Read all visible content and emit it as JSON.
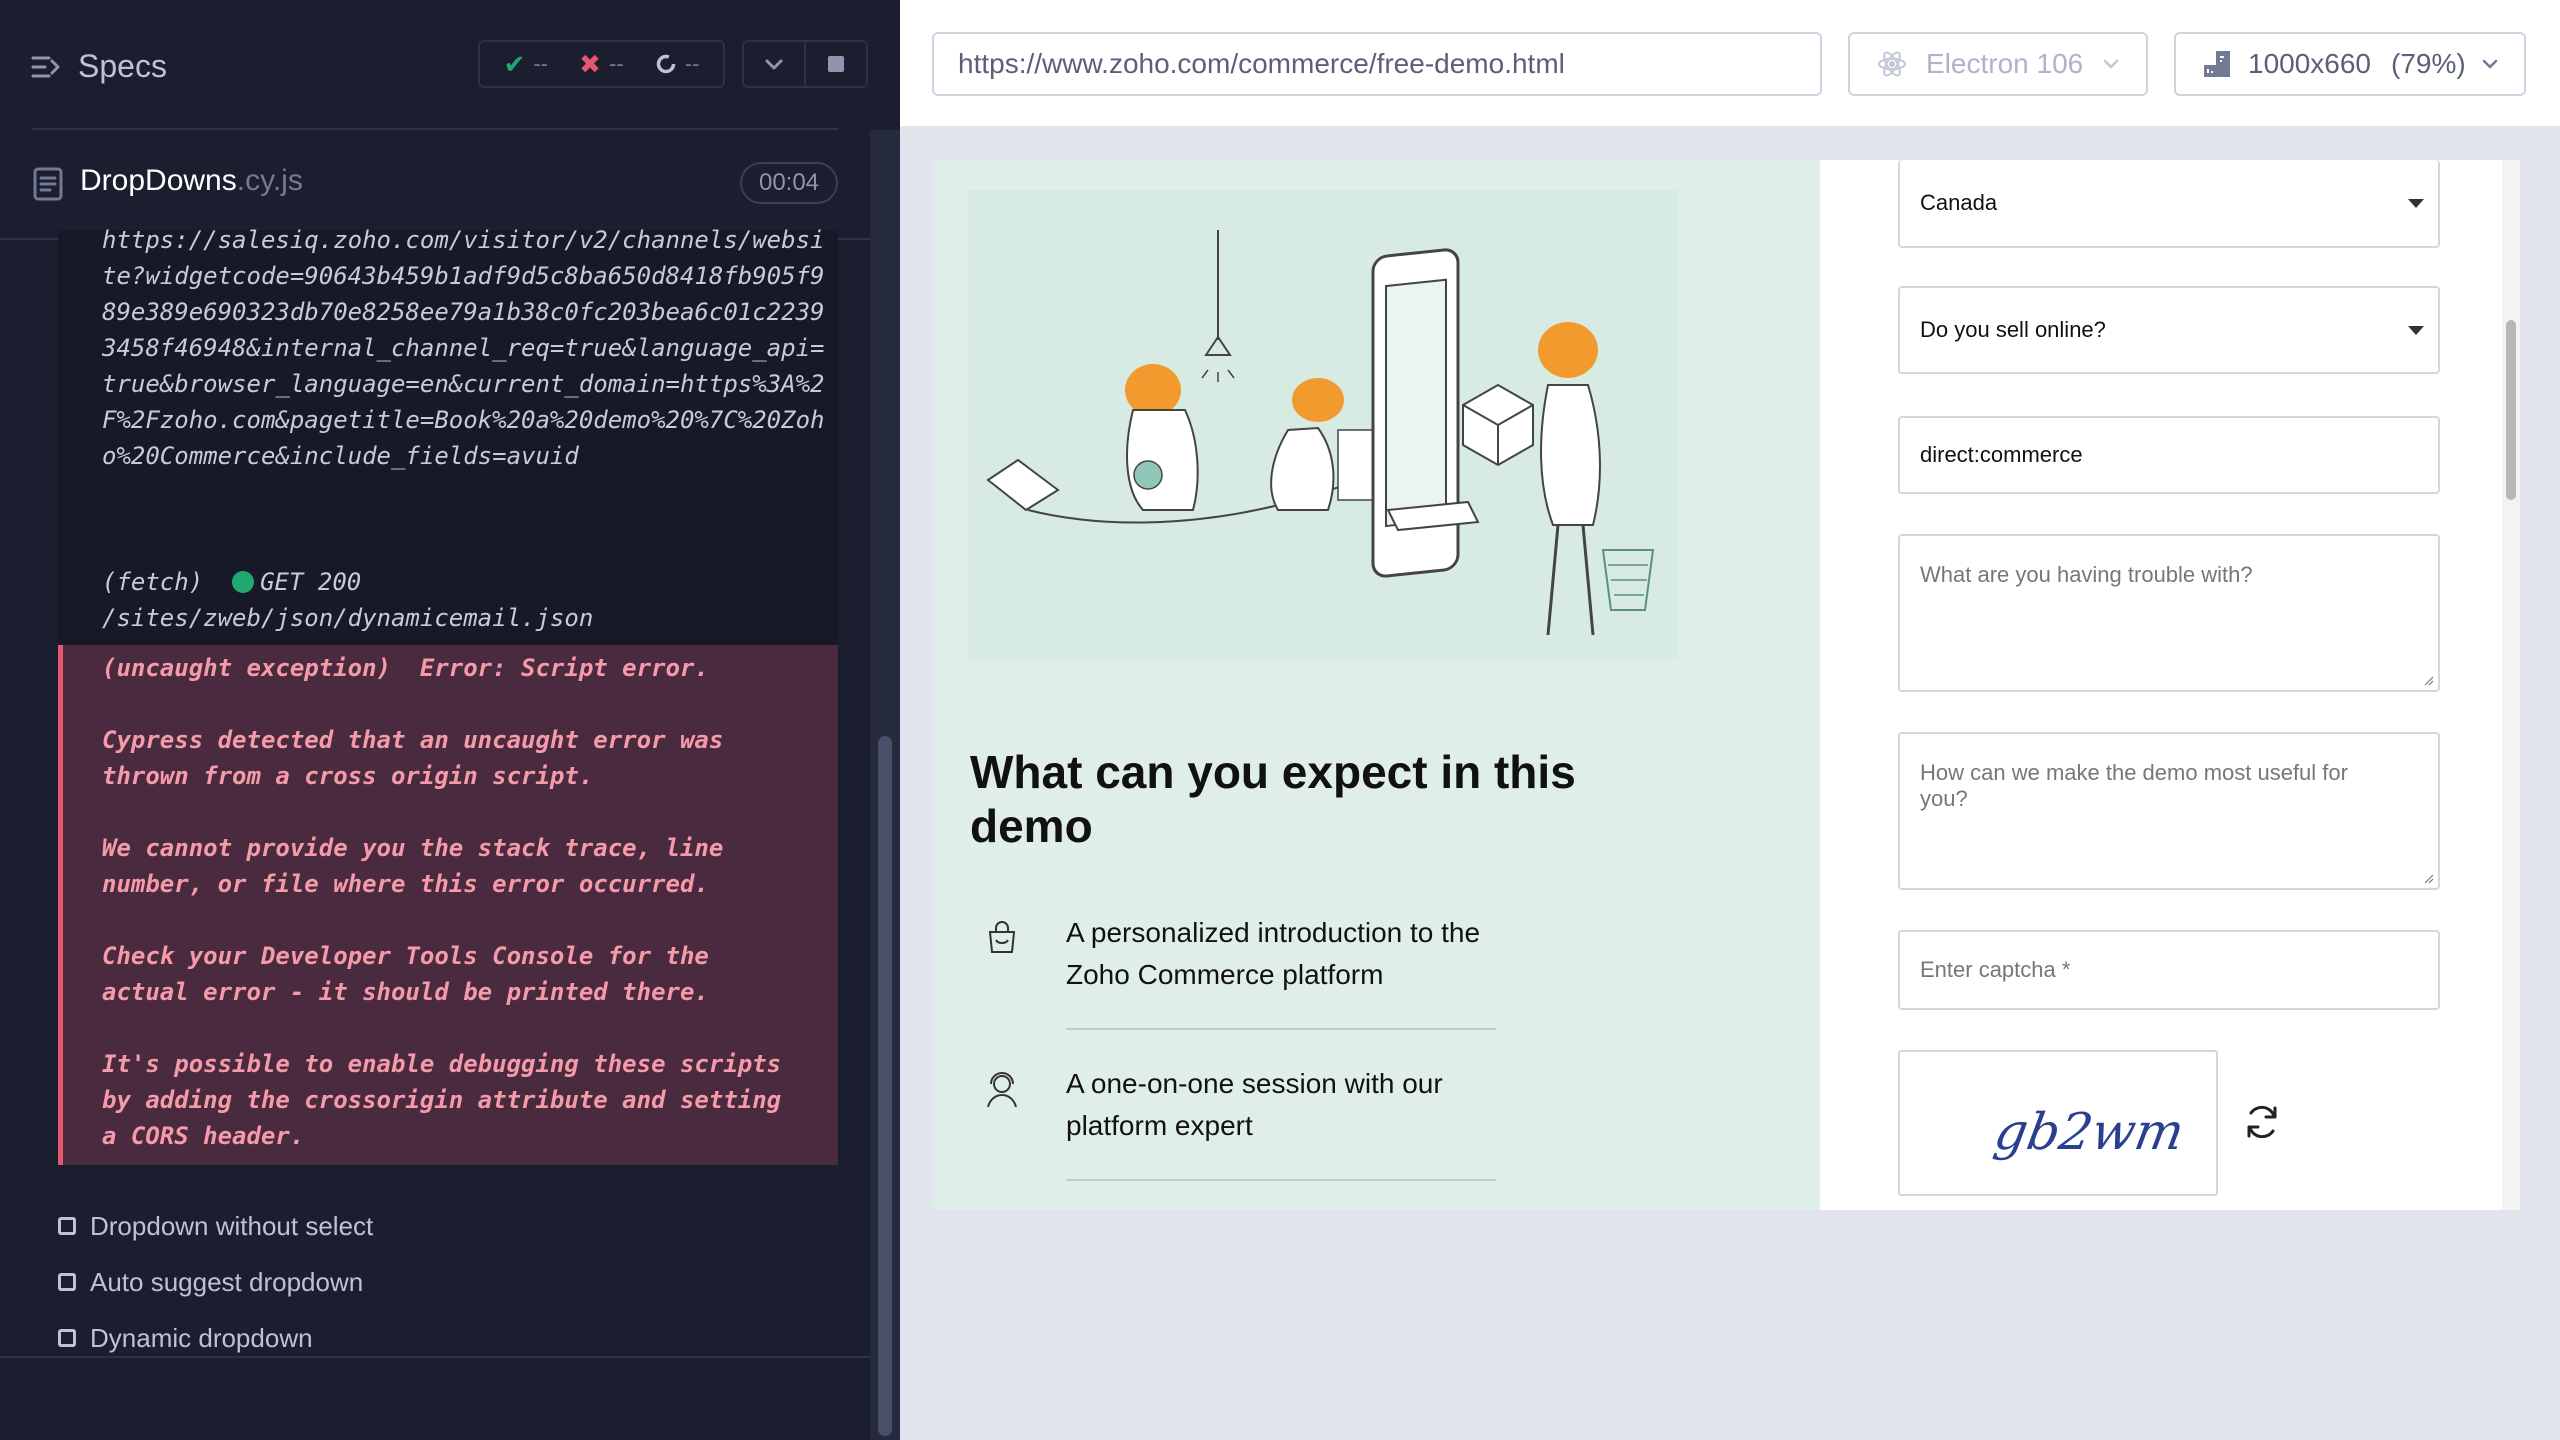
{
  "reporter": {
    "specs_label": "Specs",
    "stats": {
      "passed": "--",
      "failed": "--",
      "pending": "--"
    },
    "spec": {
      "name": "DropDowns",
      "ext": ".cy.js",
      "duration": "00:04"
    },
    "log_partial": "https://salesiq.zoho.com/visitor/v2/channels/website?widgetcode=90643b459b1adf9d5c8ba650d8418fb905f989e389e690323db70e8258ee79a1b38c0fc203bea6c01c22393458f46948&internal_channel_req=true&language_api=true&browser_language=en&current_domain=https%3A%2F%2Fzoho.com&pagetitle=Book%20a%20demo%20%7C%20Zoho%20Commerce&include_fields=avuid",
    "fetch": {
      "label": "(fetch)",
      "method": "GET",
      "status": "200",
      "path": "/sites/zweb/json/dynamicemail.json"
    },
    "error": "(uncaught exception)  Error: Script error.\n\nCypress detected that an uncaught error was thrown from a cross origin script.\n\nWe cannot provide you the stack trace, line number, or file where this error occurred.\n\nCheck your Developer Tools Console for the actual error - it should be printed there.\n\nIt's possible to enable debugging these scripts by adding the crossorigin attribute and setting a CORS header.",
    "tests": [
      "Dropdown without select",
      "Auto suggest dropdown",
      "Dynamic dropdown"
    ]
  },
  "toolbar": {
    "url": "https://www.zoho.com/commerce/free-demo.html",
    "browser": "Electron 106",
    "viewport": "1000x660",
    "zoom": "(79%)"
  },
  "page": {
    "heading": "What can you expect in this demo",
    "bullets": [
      {
        "icon": "shopping-bag-icon",
        "text": "A personalized introduction to the Zoho Commerce platform"
      },
      {
        "icon": "headset-agent-icon",
        "text": "A one-on-one session with our platform expert"
      }
    ],
    "form": {
      "country": "Canada",
      "sell_online": "Do you sell online?",
      "source": "direct:commerce",
      "trouble_placeholder": "What are you having trouble with?",
      "useful_placeholder": "How can we make the demo most useful for you?",
      "captcha_placeholder": "Enter captcha *",
      "captcha_text": "gb2wm"
    }
  }
}
